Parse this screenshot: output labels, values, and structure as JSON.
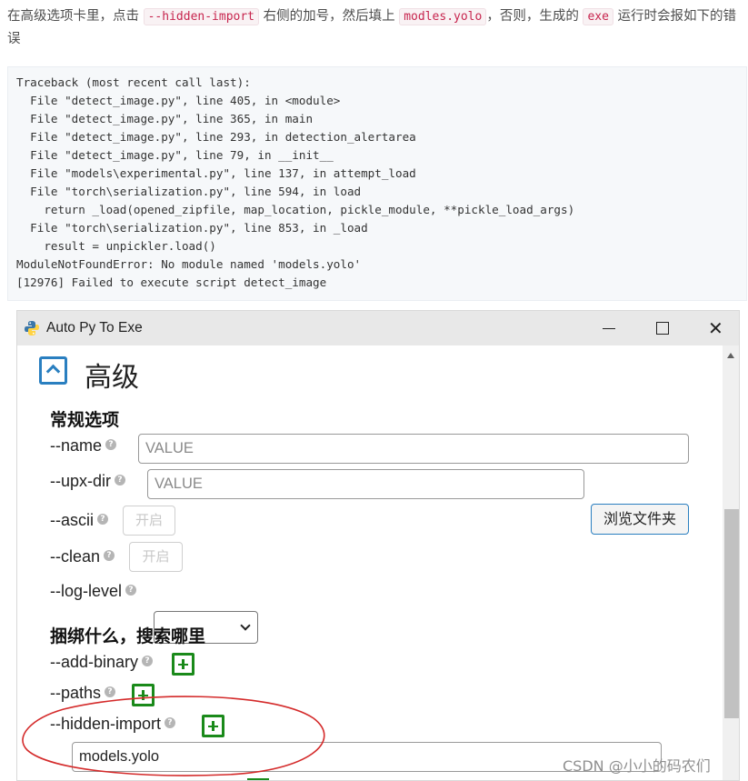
{
  "article": {
    "intro_1": "在高级选项卡里，点击",
    "code_hidden_import": "--hidden-import",
    "intro_2": "右侧的加号，然后填上",
    "code_modles_yolo": "modles.yolo",
    "intro_3": "，否则，生成的",
    "code_exe": "exe",
    "intro_4": "运行时会报如下的错误"
  },
  "traceback": [
    "Traceback (most recent call last):",
    "  File \"detect_image.py\", line 405, in <module>",
    "  File \"detect_image.py\", line 365, in main",
    "  File \"detect_image.py\", line 293, in detection_alertarea",
    "  File \"detect_image.py\", line 79, in __init__",
    "  File \"models\\experimental.py\", line 137, in attempt_load",
    "  File \"torch\\serialization.py\", line 594, in load",
    "    return _load(opened_zipfile, map_location, pickle_module, **pickle_load_args)",
    "  File \"torch\\serialization.py\", line 853, in _load",
    "    result = unpickler.load()",
    "ModuleNotFoundError: No module named 'models.yolo'",
    "[12976] Failed to execute script detect_image"
  ],
  "window": {
    "title": "Auto Py To Exe",
    "icons": {
      "app": "python-icon",
      "minimize": "minimize-icon",
      "maximize": "maximize-icon",
      "close": "close-icon"
    },
    "close_glyph": "✕"
  },
  "advanced": {
    "title": "高级",
    "general_heading": "常规选项",
    "help_glyph": "?",
    "name": {
      "label": "--name",
      "placeholder": "VALUE"
    },
    "upx_dir": {
      "label": "--upx-dir",
      "placeholder": "VALUE",
      "browse_label": "浏览文件夹"
    },
    "ascii": {
      "label": "--ascii",
      "toggle_label": "开启"
    },
    "clean": {
      "label": "--clean",
      "toggle_label": "开启"
    },
    "log_level": {
      "label": "--log-level",
      "value": ""
    },
    "bundle_heading": "捆绑什么，搜索哪里",
    "add_binary": {
      "label": "--add-binary"
    },
    "paths": {
      "label": "--paths"
    },
    "hidden_import": {
      "label": "--hidden-import",
      "value": "models.yolo"
    }
  },
  "colors": {
    "accent_blue": "#2a7fc0",
    "add_green": "#1a8a1a",
    "remove_red": "#d8262b",
    "annotation_red": "#d42a2a"
  },
  "watermark": "CSDN @小小的码农们"
}
